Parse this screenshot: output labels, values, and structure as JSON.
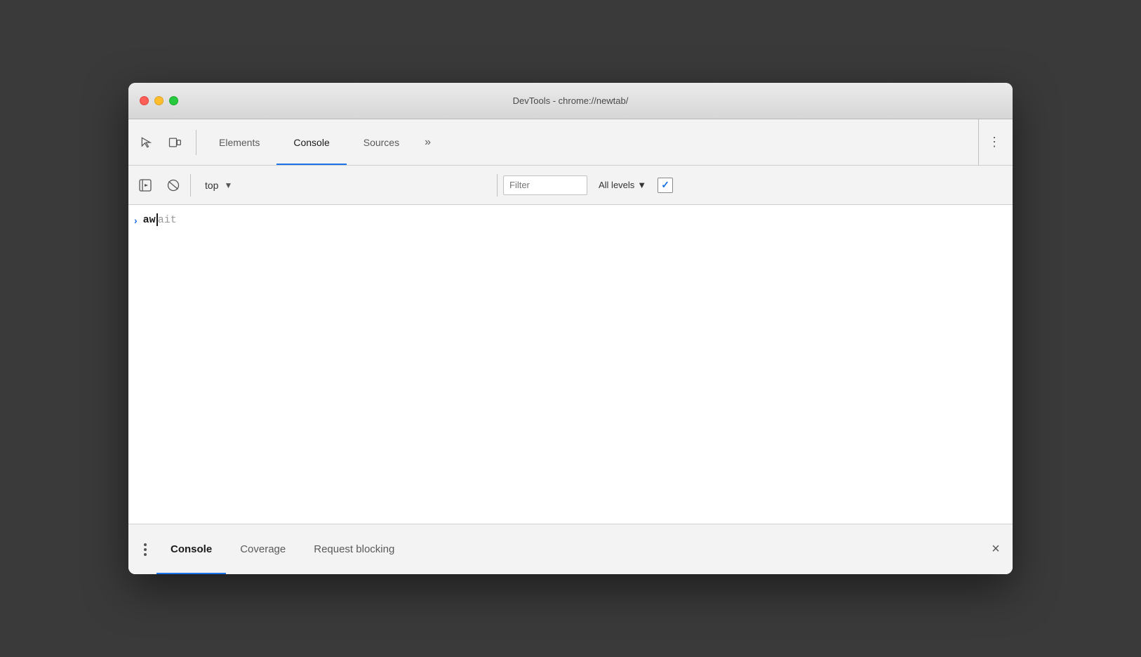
{
  "window": {
    "title": "DevTools - chrome://newtab/"
  },
  "traffic_lights": {
    "close_label": "close",
    "minimize_label": "minimize",
    "maximize_label": "maximize"
  },
  "main_toolbar": {
    "inspect_icon": "inspect-icon",
    "device_icon": "device-toolbar-icon",
    "tabs": [
      {
        "label": "Elements",
        "active": false
      },
      {
        "label": "Console",
        "active": true
      },
      {
        "label": "Sources",
        "active": false
      }
    ],
    "more_tabs_label": "»",
    "more_menu_label": "⋮"
  },
  "console_toolbar": {
    "sidebar_icon": "console-sidebar-icon",
    "clear_icon": "clear-console-icon",
    "context_label": "top",
    "dropdown_arrow": "▼",
    "filter_placeholder": "Filter",
    "levels_label": "All levels",
    "levels_arrow": "▼"
  },
  "console_entries": [
    {
      "type": "input",
      "text_typed": "aw",
      "text_grey": "ait"
    }
  ],
  "bottom_drawer": {
    "tabs": [
      {
        "label": "Console",
        "active": true
      },
      {
        "label": "Coverage",
        "active": false
      },
      {
        "label": "Request blocking",
        "active": false
      }
    ],
    "close_label": "×"
  }
}
